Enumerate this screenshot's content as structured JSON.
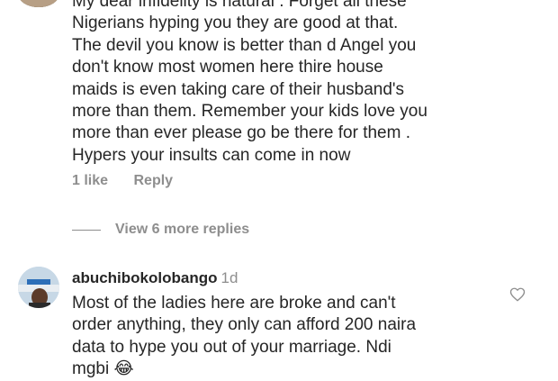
{
  "comment_1": {
    "text": "My dear infidelity is natural . Forget all these\nNigerians hyping you they are good at that.\nThe devil you know is better than d Angel you\ndon't know most women here thire house\nmaids is even taking care of their husband's\nmore than them. Remember your kids love you\nmore than ever please go be there for them .\nHypers your insults can come in now",
    "likes": "1 like",
    "reply_label": "Reply",
    "view_replies_label": "View 6 more replies"
  },
  "comment_2": {
    "username": "abuchibokolobango",
    "time": "1d",
    "text": "Most of the ladies here are broke and can't\norder anything, they only can afford 200 naira\ndata to hype you out of your marriage. Ndi\nmgbi 😂"
  },
  "icons": {
    "like": "heart-outline-icon"
  }
}
